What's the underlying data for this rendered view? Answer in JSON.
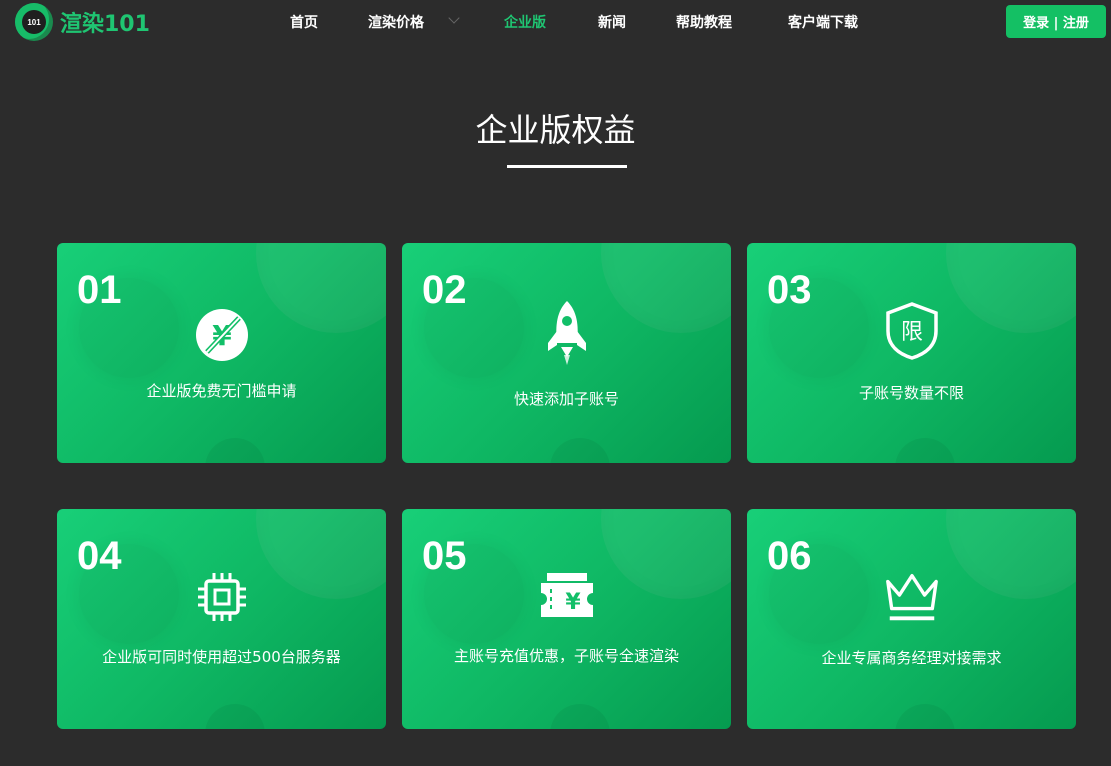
{
  "header": {
    "logo_badge": "101",
    "logo_text": "渲染101",
    "nav": [
      "首页",
      "渲染价格",
      "企业版",
      "新闻",
      "帮助教程",
      "客户端下载"
    ],
    "active_nav": "企业版",
    "login_label": "登录 | 注册"
  },
  "section": {
    "title": "企业版权益"
  },
  "cards": [
    {
      "num": "01",
      "label": "企业版免费无门槛申请",
      "icon": "no-fee-icon"
    },
    {
      "num": "02",
      "label": "快速添加子账号",
      "icon": "rocket-icon"
    },
    {
      "num": "03",
      "label": "子账号数量不限",
      "icon": "unlimited-shield-icon"
    },
    {
      "num": "04",
      "label": "企业版可同时使用超过500台服务器",
      "icon": "chip-icon"
    },
    {
      "num": "05",
      "label": "主账号充值优惠，子账号全速渲染",
      "icon": "yuan-ticket-icon"
    },
    {
      "num": "06",
      "label": "企业专属商务经理对接需求",
      "icon": "crown-icon"
    }
  ],
  "colors": {
    "accent": "#1fc572",
    "background": "#2c2c2c",
    "card_start": "#18cf78",
    "card_end": "#059a4f"
  }
}
